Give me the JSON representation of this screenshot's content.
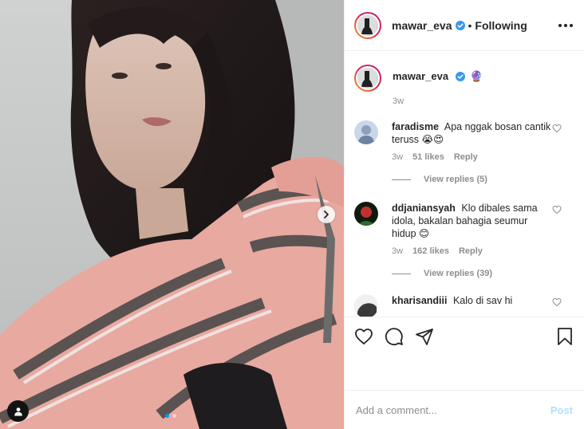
{
  "post": {
    "image_alt": "Woman with long dark wavy hair in a pink and grey striped blouse",
    "carousel": {
      "count": 2,
      "active_index": 0
    }
  },
  "header": {
    "username": "mawar_eva",
    "separator": "•",
    "follow_status": "Following"
  },
  "caption": {
    "username": "mawar_eva",
    "emoji": "🔮",
    "time": "3w"
  },
  "comments": [
    {
      "username": "faradisme",
      "text": "Apa nggak bosan cantik teruss 😭😍",
      "time": "3w",
      "likes": "51 likes",
      "reply_label": "Reply",
      "view_replies": "View replies (5)"
    },
    {
      "username": "ddjaniansyah",
      "text": "Klo dibales sama idola, bakalan bahagia seumur hidup 😊",
      "time": "3w",
      "likes": "162 likes",
      "reply_label": "Reply",
      "view_replies": "View replies (39)"
    },
    {
      "username": "kharisandiii",
      "text": "Kalo di sav hi"
    }
  ],
  "add_comment": {
    "placeholder": "Add a comment...",
    "post_label": "Post"
  },
  "colors": {
    "accent": "#0095f6",
    "post_disabled": "#b2dffc",
    "secondary_text": "#8e8e8e"
  },
  "icons": [
    "more-icon",
    "verified-badge-icon",
    "heart-icon",
    "comment-icon",
    "share-icon",
    "bookmark-icon",
    "chevron-right-icon",
    "user-tag-icon"
  ]
}
